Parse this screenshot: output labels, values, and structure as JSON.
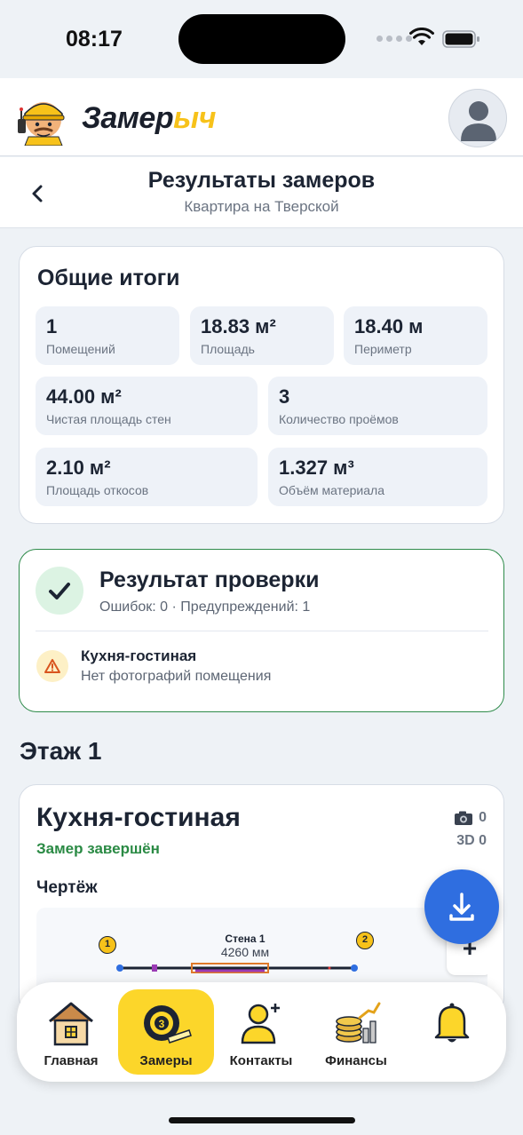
{
  "status_bar": {
    "time": "08:17"
  },
  "app": {
    "brand_part1": "Замер",
    "brand_part2": "ыч"
  },
  "page": {
    "title": "Результаты замеров",
    "subtitle": "Квартира на Тверской"
  },
  "summary": {
    "title": "Общие итоги",
    "stats": [
      {
        "value": "1",
        "label": "Помещений"
      },
      {
        "value": "18.83 м²",
        "label": "Площадь"
      },
      {
        "value": "18.40 м",
        "label": "Периметр"
      },
      {
        "value": "44.00 м²",
        "label": "Чистая площадь стен"
      },
      {
        "value": "3",
        "label": "Количество проёмов"
      },
      {
        "value": "2.10 м²",
        "label": "Площадь откосов"
      },
      {
        "value": "1.327 м³",
        "label": "Объём материала"
      }
    ]
  },
  "check": {
    "title": "Результат проверки",
    "summary": "Ошибок: 0 · Предупреждений: 1",
    "warning": {
      "title": "Кухня-гостиная",
      "text": "Нет фотографий помещения"
    }
  },
  "floor": {
    "title": "Этаж 1"
  },
  "room": {
    "name": "Кухня-гостиная",
    "status": "Замер завершён",
    "photos_count": "0",
    "model_3d": "3D 0",
    "drawing_label": "Чертёж",
    "wall_title": "Стена 1",
    "wall_length": "4260 мм",
    "corner_1": "1",
    "corner_2": "2",
    "zoom_label": "+"
  },
  "tabs": [
    {
      "label": "Главная",
      "icon": "house-icon",
      "active": false
    },
    {
      "label": "Замеры",
      "icon": "tape-measure-icon",
      "active": true
    },
    {
      "label": "Контакты",
      "icon": "add-contact-icon",
      "active": false
    },
    {
      "label": "Финансы",
      "icon": "coins-icon",
      "active": false
    },
    {
      "label": "",
      "icon": "bell-icon",
      "active": false
    }
  ],
  "colors": {
    "accent_yellow": "#fcd62a",
    "success_green": "#2a8a44",
    "fab_blue": "#2f6ee0",
    "background": "#eef2f6"
  }
}
